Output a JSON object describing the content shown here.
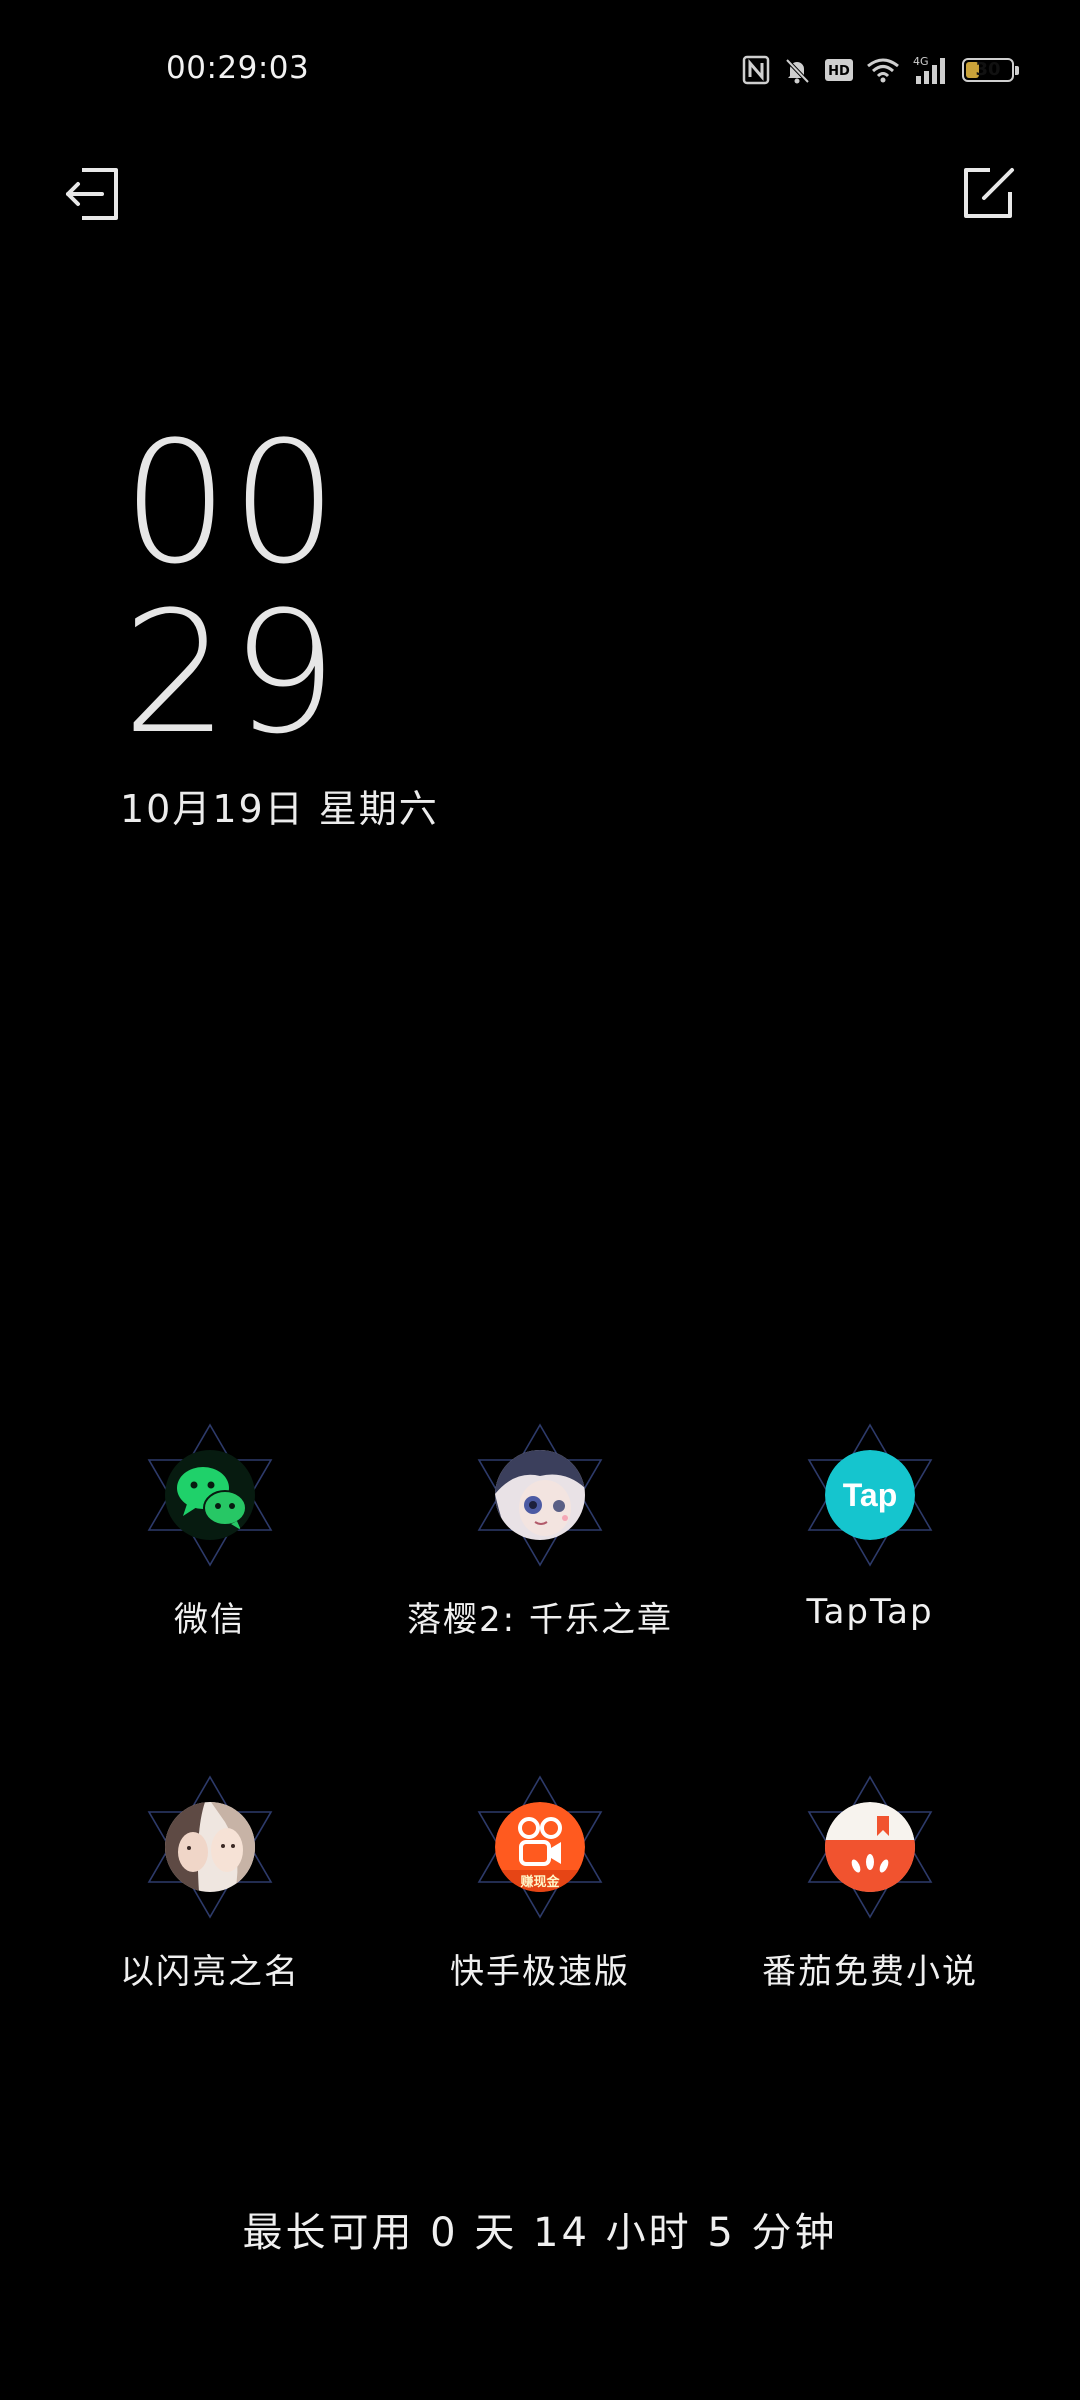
{
  "status_bar": {
    "time": "00:29:03",
    "icons": [
      "nfc-icon",
      "bell-off-icon",
      "hd-icon",
      "wifi-icon",
      "signal-4g-icon",
      "battery-icon"
    ],
    "network_label": "4G",
    "hd_label": "HD",
    "battery_percent": "30",
    "battery_level": 0.3
  },
  "toolbar": {
    "exit_icon": "exit-icon",
    "edit_icon": "edit-icon"
  },
  "clock": {
    "hours": "00",
    "minutes": "29",
    "date": "10月19日  星期六"
  },
  "apps": [
    {
      "label": "微信",
      "icon": "wechat-icon",
      "color": "#1fd16a"
    },
    {
      "label": "落樱2: 千乐之章",
      "icon": "luoying-icon",
      "color": "#6c7aa8"
    },
    {
      "label": "TapTap",
      "icon": "taptap-icon",
      "color": "#15c5ce",
      "icon_text": "Tap"
    },
    {
      "label": "以闪亮之名",
      "icon": "yishanliang-icon",
      "color": "#d8b7a3"
    },
    {
      "label": "快手极速版",
      "icon": "kuaishou-icon",
      "color": "#ff5a1f",
      "icon_text": "赚现金"
    },
    {
      "label": "番茄免费小说",
      "icon": "fanqie-icon",
      "color": "#f1532f"
    }
  ],
  "footer": {
    "text": "最长可用 0 天 14 小时 5 分钟"
  }
}
